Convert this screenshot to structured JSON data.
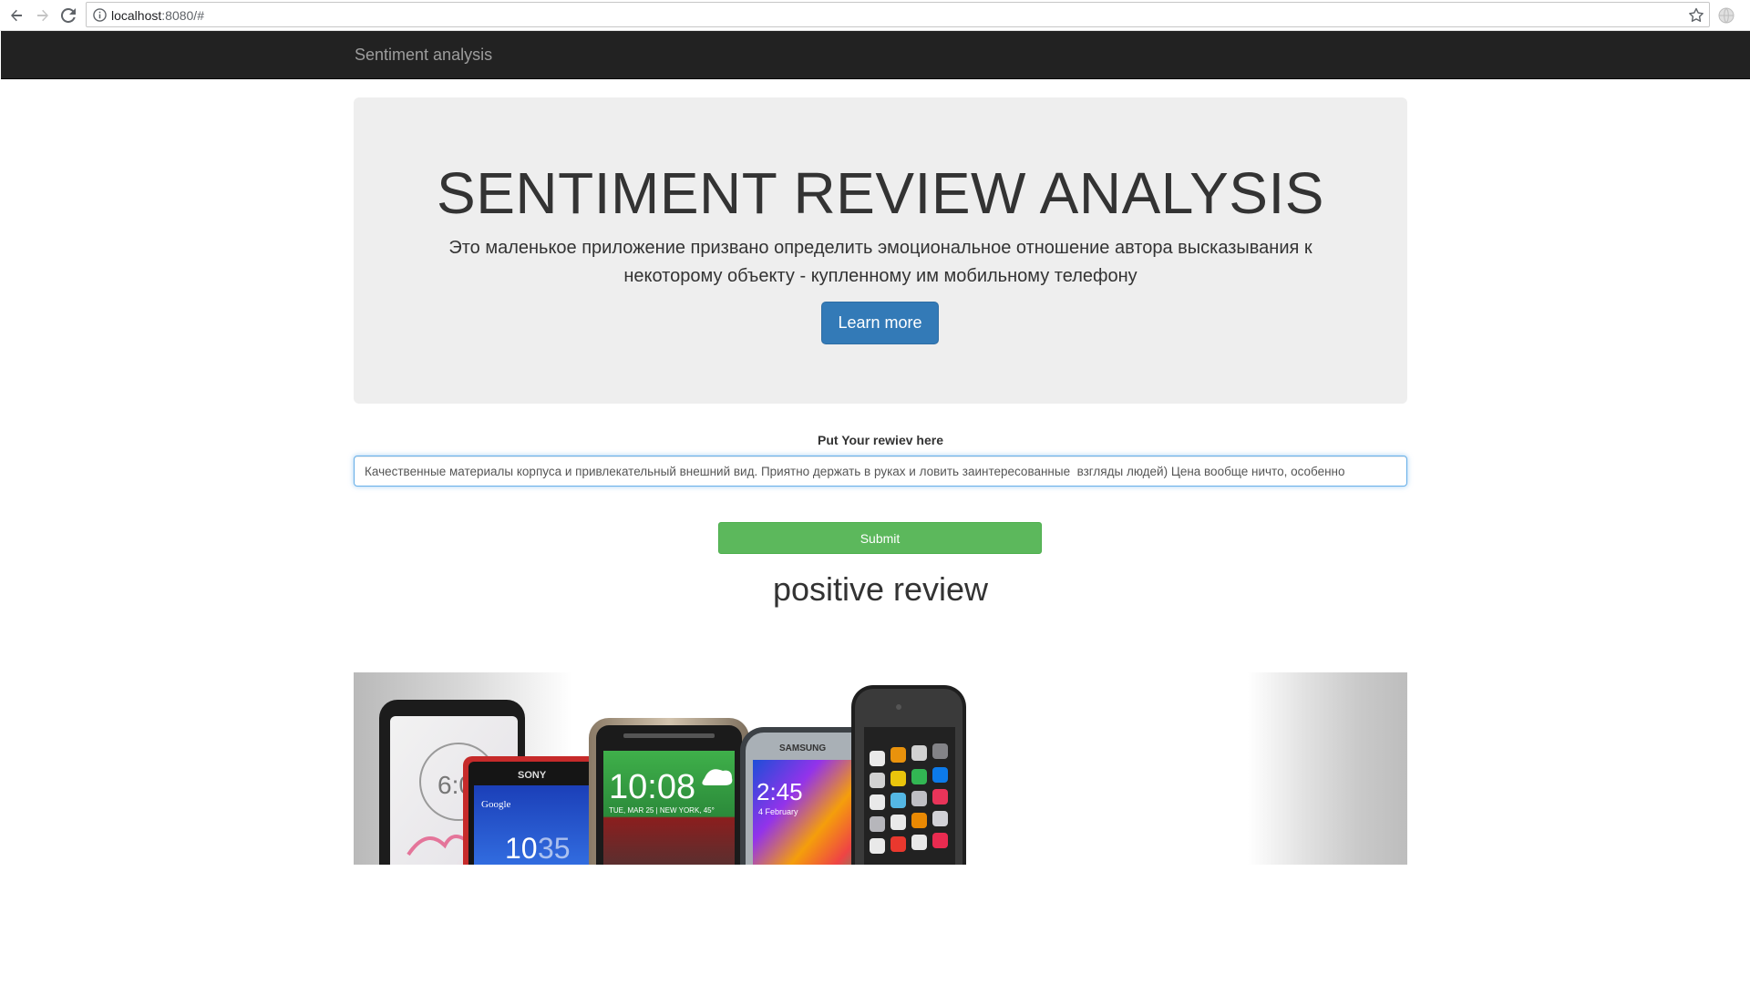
{
  "browser": {
    "url_host": "localhost",
    "url_rest": ":8080/#",
    "icons": [
      "back-icon",
      "forward-icon",
      "reload-icon",
      "info-icon",
      "star-icon",
      "extension-icon"
    ]
  },
  "navbar": {
    "brand": "Sentiment analysis"
  },
  "jumbotron": {
    "title": "SENTIMENT REVIEW ANALYSIS",
    "description": "Это маленькое приложение призвано определить эмоциональное отношение автора высказывания к некоторому объекту - купленному им мобильному телефону",
    "learn_more_label": "Learn more"
  },
  "form": {
    "label": "Put Your rewiev here",
    "review_value": "Качественные материалы корпуса и привлекательный внешний вид. Приятно держать в руках и ловить заинтересованные  взгляды людей) Цена вообще ничто, особенно",
    "submit_label": "Submit"
  },
  "result": {
    "text": "positive review"
  },
  "phones_image": {
    "sony_brand": "SONY",
    "samsung_brand": "SAMSUNG",
    "htc_time": "10:08",
    "htc_date": "TUE, MAR 25 | NEW YORK, 45°",
    "sony_time": "10",
    "sony_time_min": "35",
    "samsung_time": "2:45",
    "samsung_date": "4 February",
    "lg_time": "6:0",
    "google_label": "Google",
    "colors": {
      "accent_blue": "#337ab7",
      "submit_green": "#5cb85c",
      "navbar_bg": "#222222",
      "jumbotron_bg": "#eeeeee"
    }
  }
}
